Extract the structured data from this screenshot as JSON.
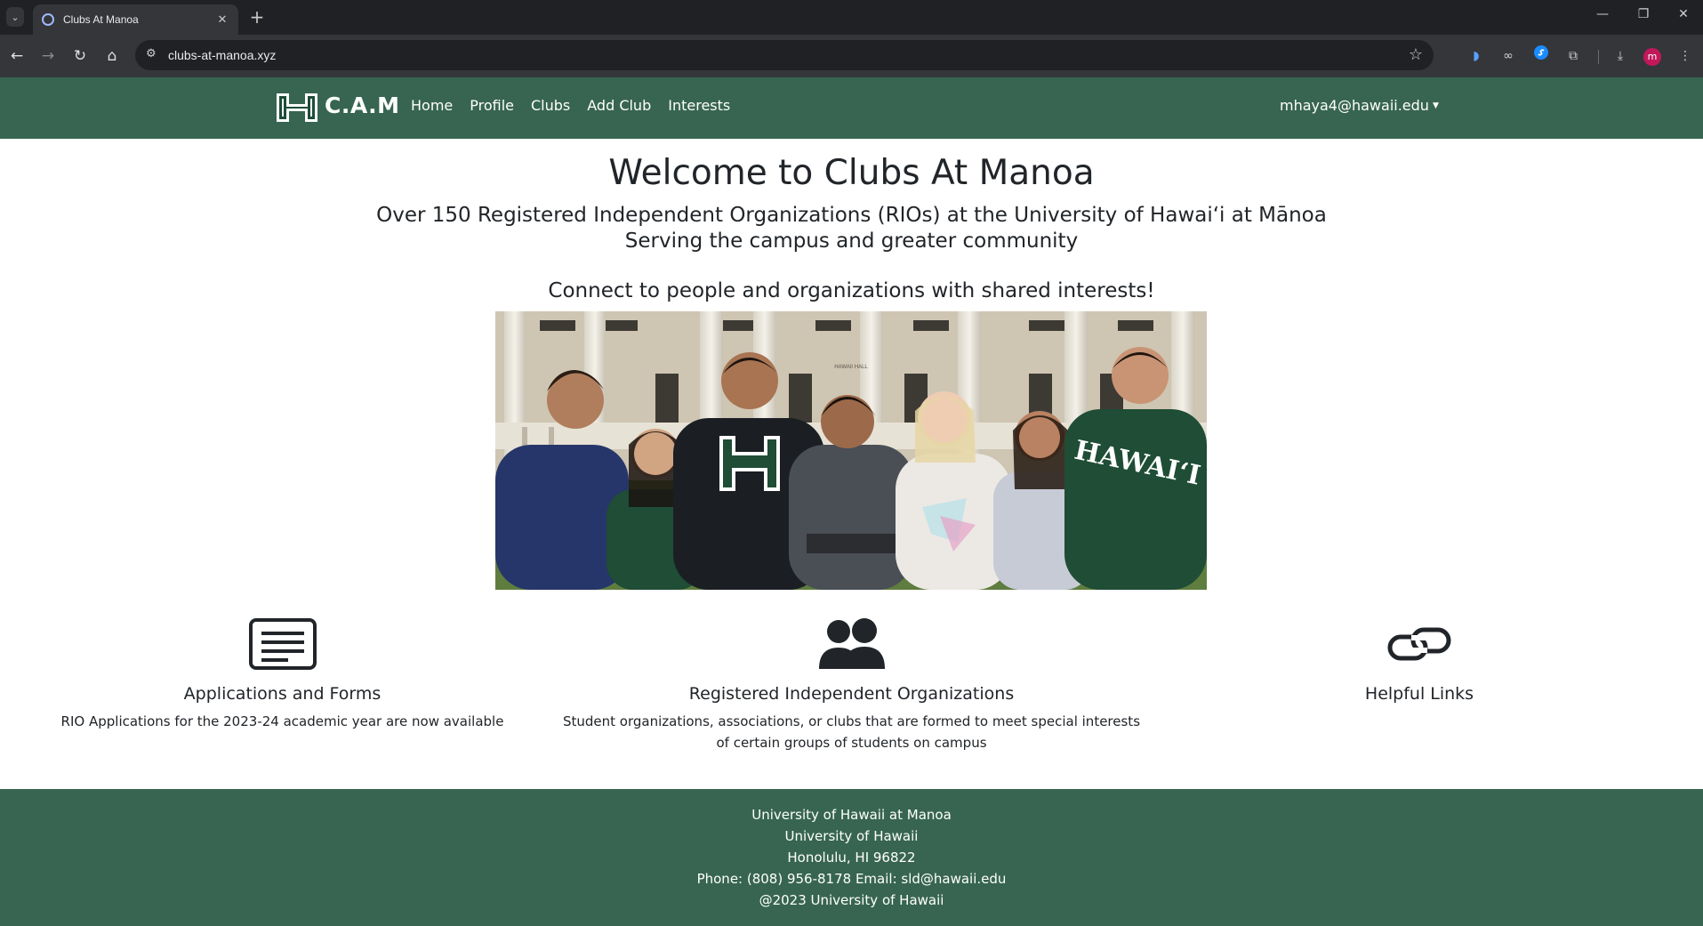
{
  "browser": {
    "tab_title": "Clubs At Manoa",
    "url": "clubs-at-manoa.xyz",
    "profile_initial": "m"
  },
  "navbar": {
    "brand": "C.A.M",
    "links": [
      "Home",
      "Profile",
      "Clubs",
      "Add Club",
      "Interests"
    ],
    "user_email": "mhaya4@hawaii.edu"
  },
  "hero": {
    "title": "Welcome to Clubs At Manoa",
    "subtitle_line1": "Over 150 Registered Independent Organizations (RIOs) at the University of Hawaiʻi at Mānoa",
    "subtitle_line2": "Serving the campus and greater community",
    "tagline": "Connect to people and organizations with shared interests!",
    "shirt_text": "HAWAIʻI",
    "building_text": "HAWAII HALL"
  },
  "features": [
    {
      "icon": "form-document-icon",
      "title": "Applications and Forms",
      "text": "RIO Applications for the 2023-24 academic year are now available"
    },
    {
      "icon": "people-group-icon",
      "title": "Registered Independent Organizations",
      "text_line1": "Student organizations, associations, or clubs that are formed to meet special interests",
      "text_line2": "of certain groups of students on campus"
    },
    {
      "icon": "link-icon",
      "title": "Helpful Links"
    }
  ],
  "footer": {
    "lines": [
      "University of Hawaii at Manoa",
      "University of Hawaii",
      "Honolulu, HI 96822",
      "Phone: (808) 956-8178 Email: sld@hawaii.edu",
      "@2023 University of Hawaii"
    ]
  },
  "colors": {
    "brand_green": "#376551",
    "text_dark": "#212529"
  }
}
